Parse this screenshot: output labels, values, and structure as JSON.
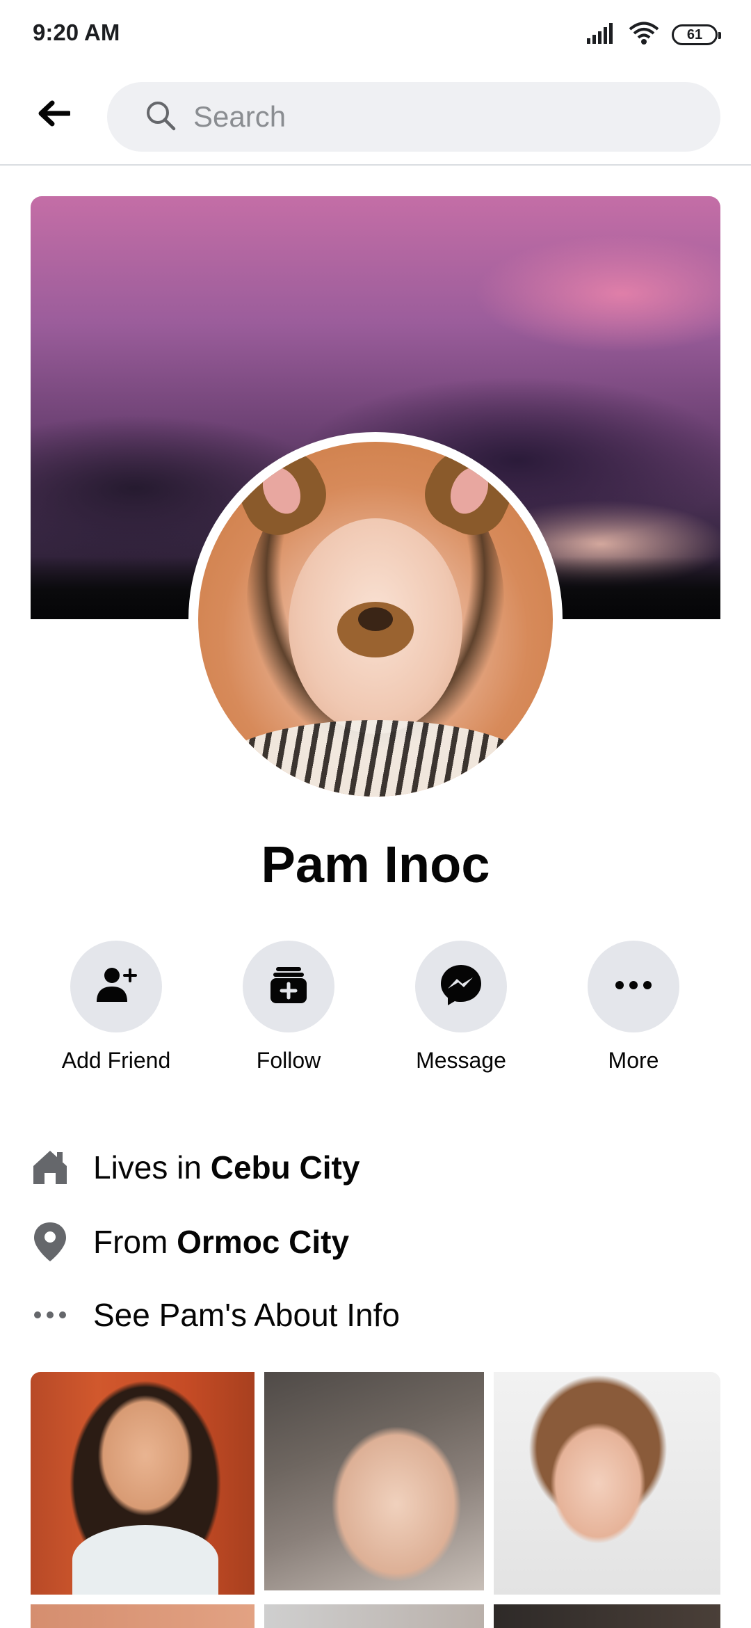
{
  "status_bar": {
    "time": "9:20 AM",
    "battery": "61",
    "icons": [
      "signal-icon",
      "wifi-icon",
      "battery-icon"
    ]
  },
  "header": {
    "back_icon": "back-arrow-icon",
    "search_placeholder": "Search"
  },
  "profile": {
    "name": "Pam Inoc",
    "cover_photo": "sunset-clouds-cover",
    "avatar": "profile-photo-dog-filter"
  },
  "actions": [
    {
      "label": "Add Friend",
      "icon": "add-friend-icon"
    },
    {
      "label": "Follow",
      "icon": "follow-icon"
    },
    {
      "label": "Message",
      "icon": "messenger-icon"
    },
    {
      "label": "More",
      "icon": "more-icon"
    }
  ],
  "info": {
    "lives": {
      "prefix": "Lives in ",
      "place": "Cebu City",
      "icon": "home-icon"
    },
    "from": {
      "prefix": "From ",
      "place": "Ormoc City",
      "icon": "location-pin-icon"
    },
    "about": {
      "text": "See Pam's About Info",
      "icon": "more-dots-icon"
    }
  },
  "photos": {
    "count_visible": 6
  },
  "colors": {
    "icon_dark": "#050505",
    "action_bg": "#e4e6eb",
    "search_bg": "#eff0f3",
    "muted_icon": "#65676b"
  }
}
